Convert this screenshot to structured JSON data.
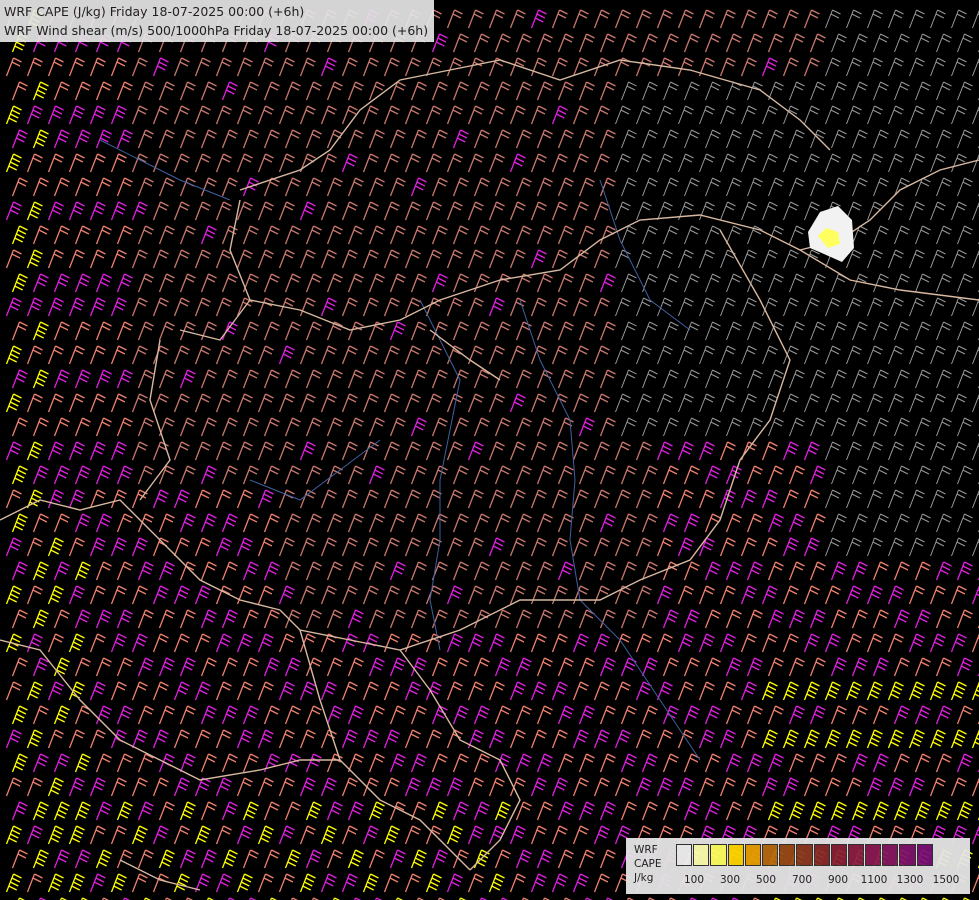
{
  "header": {
    "line1": "WRF CAPE (J/kg) Friday 18-07-2025 00:00 (+6h)",
    "line2": "WRF Wind shear (m/s) 500/1000hPa Friday 18-07-2025 00:00 (+6h)"
  },
  "legend": {
    "label_model": "WRF",
    "label_var": "CAPE",
    "label_unit": "J/kg",
    "colors": [
      "#f2f2f2",
      "#ffffb0",
      "#ffff60",
      "#ffd700",
      "#e8a000",
      "#b86a10",
      "#9a4a18",
      "#8c3a20",
      "#8a2a2a",
      "#8a2036",
      "#8c1e44",
      "#8a1a52",
      "#861860",
      "#80146c",
      "#7a1078"
    ],
    "ticks": [
      "100",
      "300",
      "500",
      "700",
      "900",
      "1100",
      "1300",
      "1500"
    ]
  },
  "map": {
    "shear_colors": {
      "low": "#9a9a9a",
      "medium": "#c8786e",
      "high": "#f08070",
      "very_high": "#e020e0",
      "extreme": "#ffff00"
    },
    "border_color": "#d8b8a0",
    "river_color": "#4060a0"
  }
}
